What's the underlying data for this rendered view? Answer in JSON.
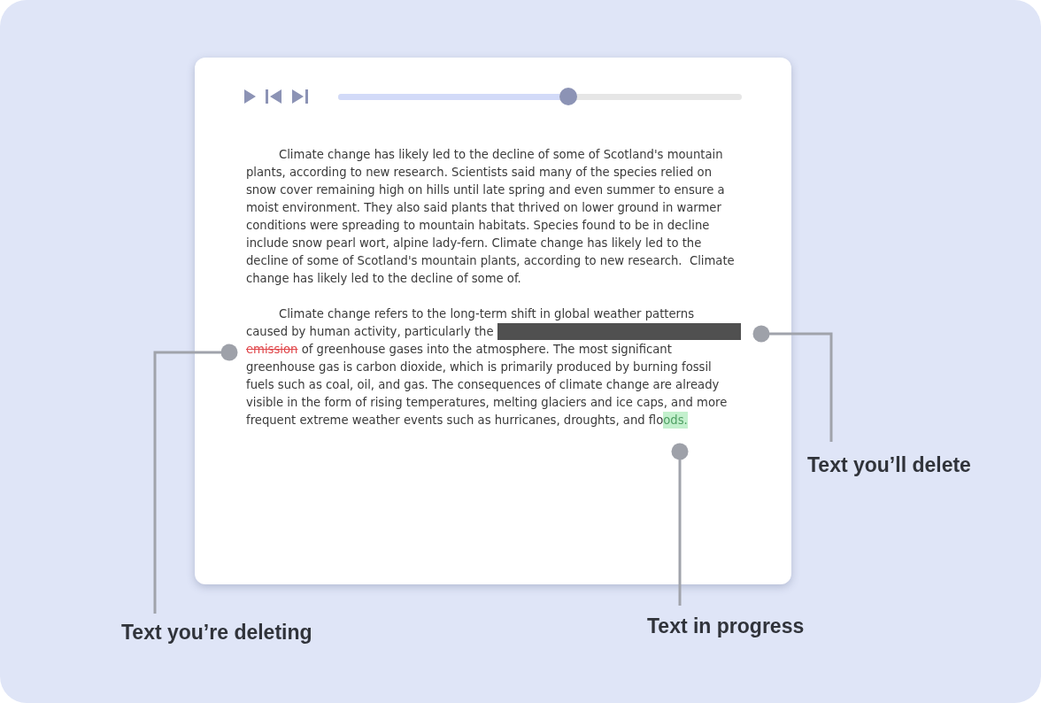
{
  "player": {
    "progress": {
      "level": 0.57
    }
  },
  "document": {
    "paragraphs": [
      {
        "segments": [
          {
            "kind": "text",
            "text": "Climate change has likely led to the decline of some of Scotland's mountain plants, according to new research. Scientists said many of the species relied on snow cover remaining high on hills until late spring and even summer to ensure a moist environment. They also said plants that thrived on lower ground in warmer conditions were spreading to mountain habitats. Species found to be in decline include snow pearl wort, alpine lady-fern. Climate change has likely led to the decline of some of Scotland's mountain plants, according to new research.  Climate change has likely led to the decline of some of."
          }
        ]
      },
      {
        "segments": [
          {
            "kind": "text",
            "text": "Climate change refers to the long-term shift in global weather patterns caused by human activity, particularly the "
          },
          {
            "kind": "pending_delete"
          },
          {
            "kind": "deleting",
            "text": "emission"
          },
          {
            "kind": "text",
            "text": " of greenhouse gases into the atmosphere. The most significant greenhouse gas is carbon dioxide, which is primarily produced by burning fossil fuels such as coal, oil, and gas. The consequences of climate change are already visible in the form of rising temperatures, melting glaciers and ice caps, and more frequent extreme weather events such as hurricanes, droughts, and flo"
          },
          {
            "kind": "in_progress",
            "text": "ods."
          }
        ]
      }
    ]
  },
  "callouts": [
    {
      "label": "Text you’ll delete"
    },
    {
      "label": "Text you’re deleting"
    },
    {
      "label": "Text in progress"
    }
  ]
}
